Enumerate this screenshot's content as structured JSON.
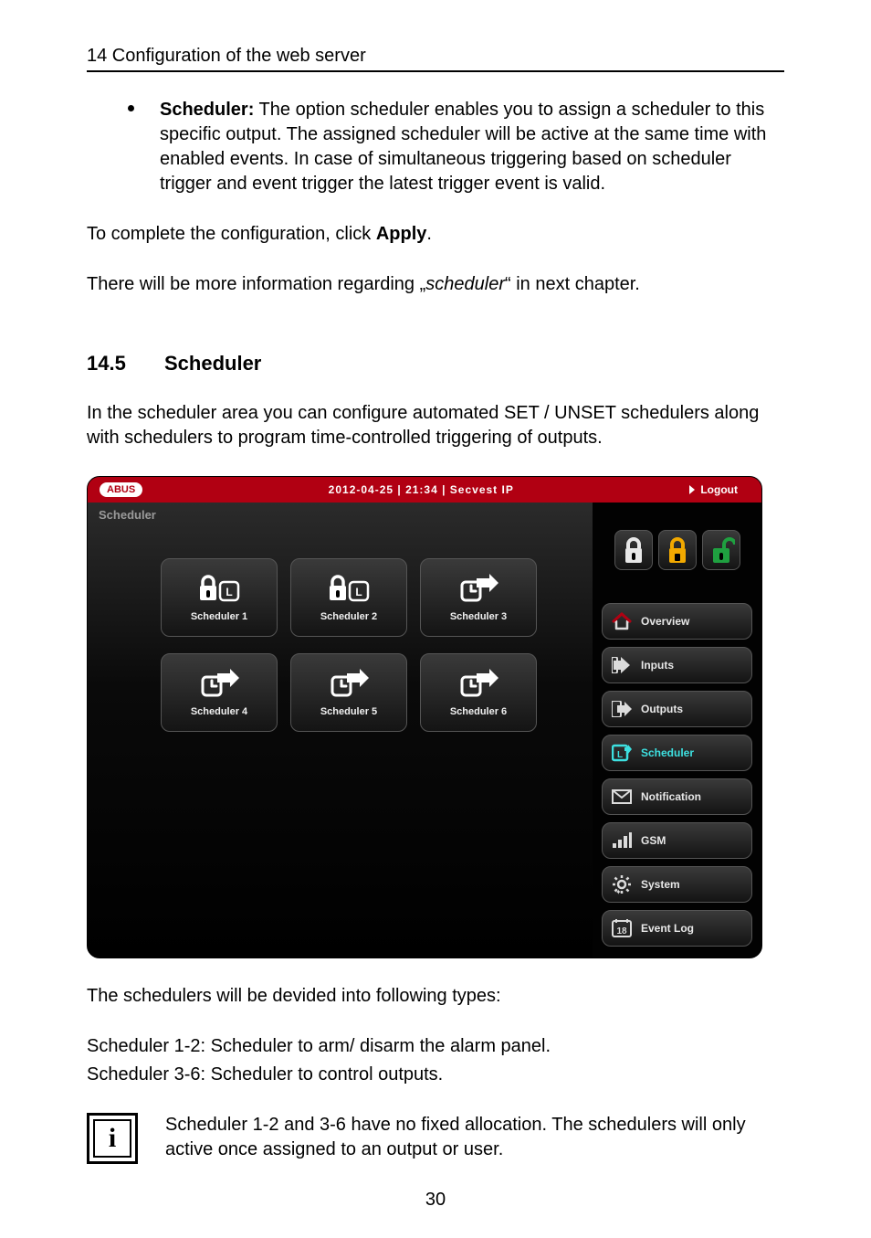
{
  "doc": {
    "heading": "14  Configuration of the web server",
    "bullet_label": "Scheduler:",
    "bullet_text": " The option scheduler enables you to assign a scheduler to this specific output. The assigned scheduler will be active at the same time with enabled events. In case of simultaneous triggering based on scheduler trigger and event trigger the latest trigger event is valid.",
    "apply_line_pre": "To complete the configuration, click ",
    "apply_word": "Apply",
    "apply_line_post": ".",
    "more_info_pre": "There will be more information regarding „",
    "more_info_em": "scheduler",
    "more_info_post": "“ in next chapter.",
    "section_num": "14.5",
    "section_title": "Scheduler",
    "section_para": "In the scheduler area you can configure automated SET / UNSET schedulers along with schedulers to program time-controlled triggering of outputs.",
    "types_intro": "The schedulers will be devided into following types:",
    "type_line1": "Scheduler 1-2: Scheduler to arm/ disarm the alarm panel.",
    "type_line2": "Scheduler 3-6: Scheduler to control outputs.",
    "info_note": "Scheduler 1-2 and 3-6 have no fixed allocation. The schedulers will only active once assigned to an output or user.",
    "page_number": "30"
  },
  "app": {
    "logo": "ABUS",
    "header_center": "2012-04-25  |  21:34  |  Secvest IP",
    "logout": "Logout",
    "breadcrumb": "Scheduler",
    "schedulers": [
      {
        "label": "Scheduler 1",
        "kind": "lock"
      },
      {
        "label": "Scheduler 2",
        "kind": "lock"
      },
      {
        "label": "Scheduler 3",
        "kind": "clock"
      },
      {
        "label": "Scheduler 4",
        "kind": "clock"
      },
      {
        "label": "Scheduler 5",
        "kind": "clock"
      },
      {
        "label": "Scheduler 6",
        "kind": "clock"
      }
    ],
    "status_icons": [
      "lock-closed",
      "lock-home",
      "lock-open"
    ],
    "nav": [
      {
        "label": "Overview",
        "icon": "house",
        "active": false
      },
      {
        "label": "Inputs",
        "icon": "arrow-in",
        "active": false
      },
      {
        "label": "Outputs",
        "icon": "arrow-out",
        "active": false
      },
      {
        "label": "Scheduler",
        "icon": "calendar",
        "active": true
      },
      {
        "label": "Notification",
        "icon": "envelope",
        "active": false
      },
      {
        "label": "GSM",
        "icon": "signal",
        "active": false
      },
      {
        "label": "System",
        "icon": "gear",
        "active": false
      },
      {
        "label": "Event Log",
        "icon": "eighteen",
        "active": false
      }
    ]
  }
}
